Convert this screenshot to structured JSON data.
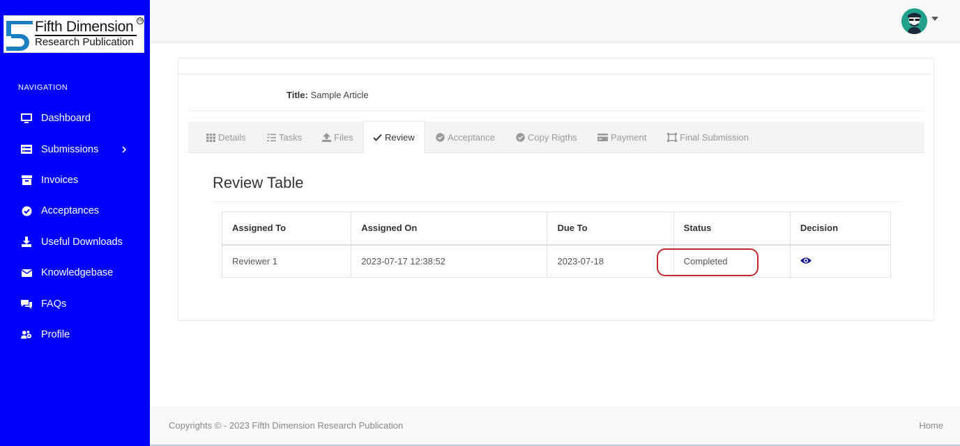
{
  "brand": {
    "name_line1": "Fifth Dimension",
    "name_line2": "Research Publication",
    "tm": "TM"
  },
  "sidebar": {
    "heading": "NAVIGATION",
    "items": [
      {
        "label": "Dashboard",
        "icon": "monitor-icon"
      },
      {
        "label": "Submissions",
        "icon": "list-icon",
        "has_caret": true
      },
      {
        "label": "Invoices",
        "icon": "archive-icon"
      },
      {
        "label": "Acceptances",
        "icon": "check-circle-icon"
      },
      {
        "label": "Useful Downloads",
        "icon": "download-icon"
      },
      {
        "label": "Knowledgebase",
        "icon": "envelope-icon"
      },
      {
        "label": "FAQs",
        "icon": "comments-icon"
      },
      {
        "label": "Profile",
        "icon": "users-cog-icon"
      }
    ]
  },
  "article": {
    "title_label": "Title:",
    "title_value": "Sample Article"
  },
  "tabs": [
    {
      "label": "Details",
      "icon": "grid-icon"
    },
    {
      "label": "Tasks",
      "icon": "tasks-icon"
    },
    {
      "label": "Files",
      "icon": "upload-icon"
    },
    {
      "label": "Review",
      "icon": "check-icon",
      "active": true
    },
    {
      "label": "Acceptance",
      "icon": "check-circle-icon"
    },
    {
      "label": "Copy Rigths",
      "icon": "check-circle-icon"
    },
    {
      "label": "Payment",
      "icon": "credit-card-icon"
    },
    {
      "label": "Final Submission",
      "icon": "final-submission-icon"
    }
  ],
  "review": {
    "heading": "Review Table",
    "columns": [
      "Assigned To",
      "Assigned On",
      "Due To",
      "Status",
      "Decision"
    ],
    "rows": [
      {
        "assigned_to": "Reviewer 1",
        "assigned_on": "2023-07-17 12:38:52",
        "due_to": "2023-07-18",
        "status": "Completed",
        "decision_icon": "eye-icon"
      }
    ]
  },
  "footer": {
    "copyright": "Copyrights © - 2023 Fifth Dimension Research Publication",
    "home_link": "Home"
  },
  "colors": {
    "sidebar_bg": "#0000ff",
    "highlight": "#c0282e",
    "eye_icon": "#1a1a8c",
    "avatar_bg": "#21a08c"
  }
}
